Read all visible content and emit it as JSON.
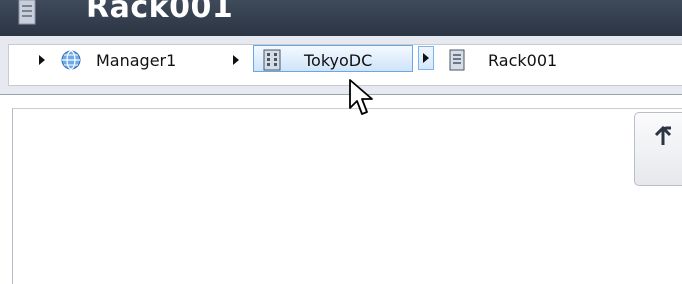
{
  "window": {
    "title": "Rack001",
    "icon": "rack-icon"
  },
  "breadcrumb": {
    "items": [
      {
        "label": "Manager1",
        "icon": "globe-icon"
      },
      {
        "label": "TokyoDC",
        "icon": "building-icon"
      },
      {
        "label": "Rack001",
        "icon": "rack-icon"
      }
    ]
  },
  "toolbar": {
    "refresh_icon": "refresh-icon"
  },
  "colors": {
    "title_bar": "#2b3544",
    "crumb_hover": "#cfe4fa",
    "crumb_hover_border": "#6aa8e4",
    "background": "#e6e9ef"
  }
}
